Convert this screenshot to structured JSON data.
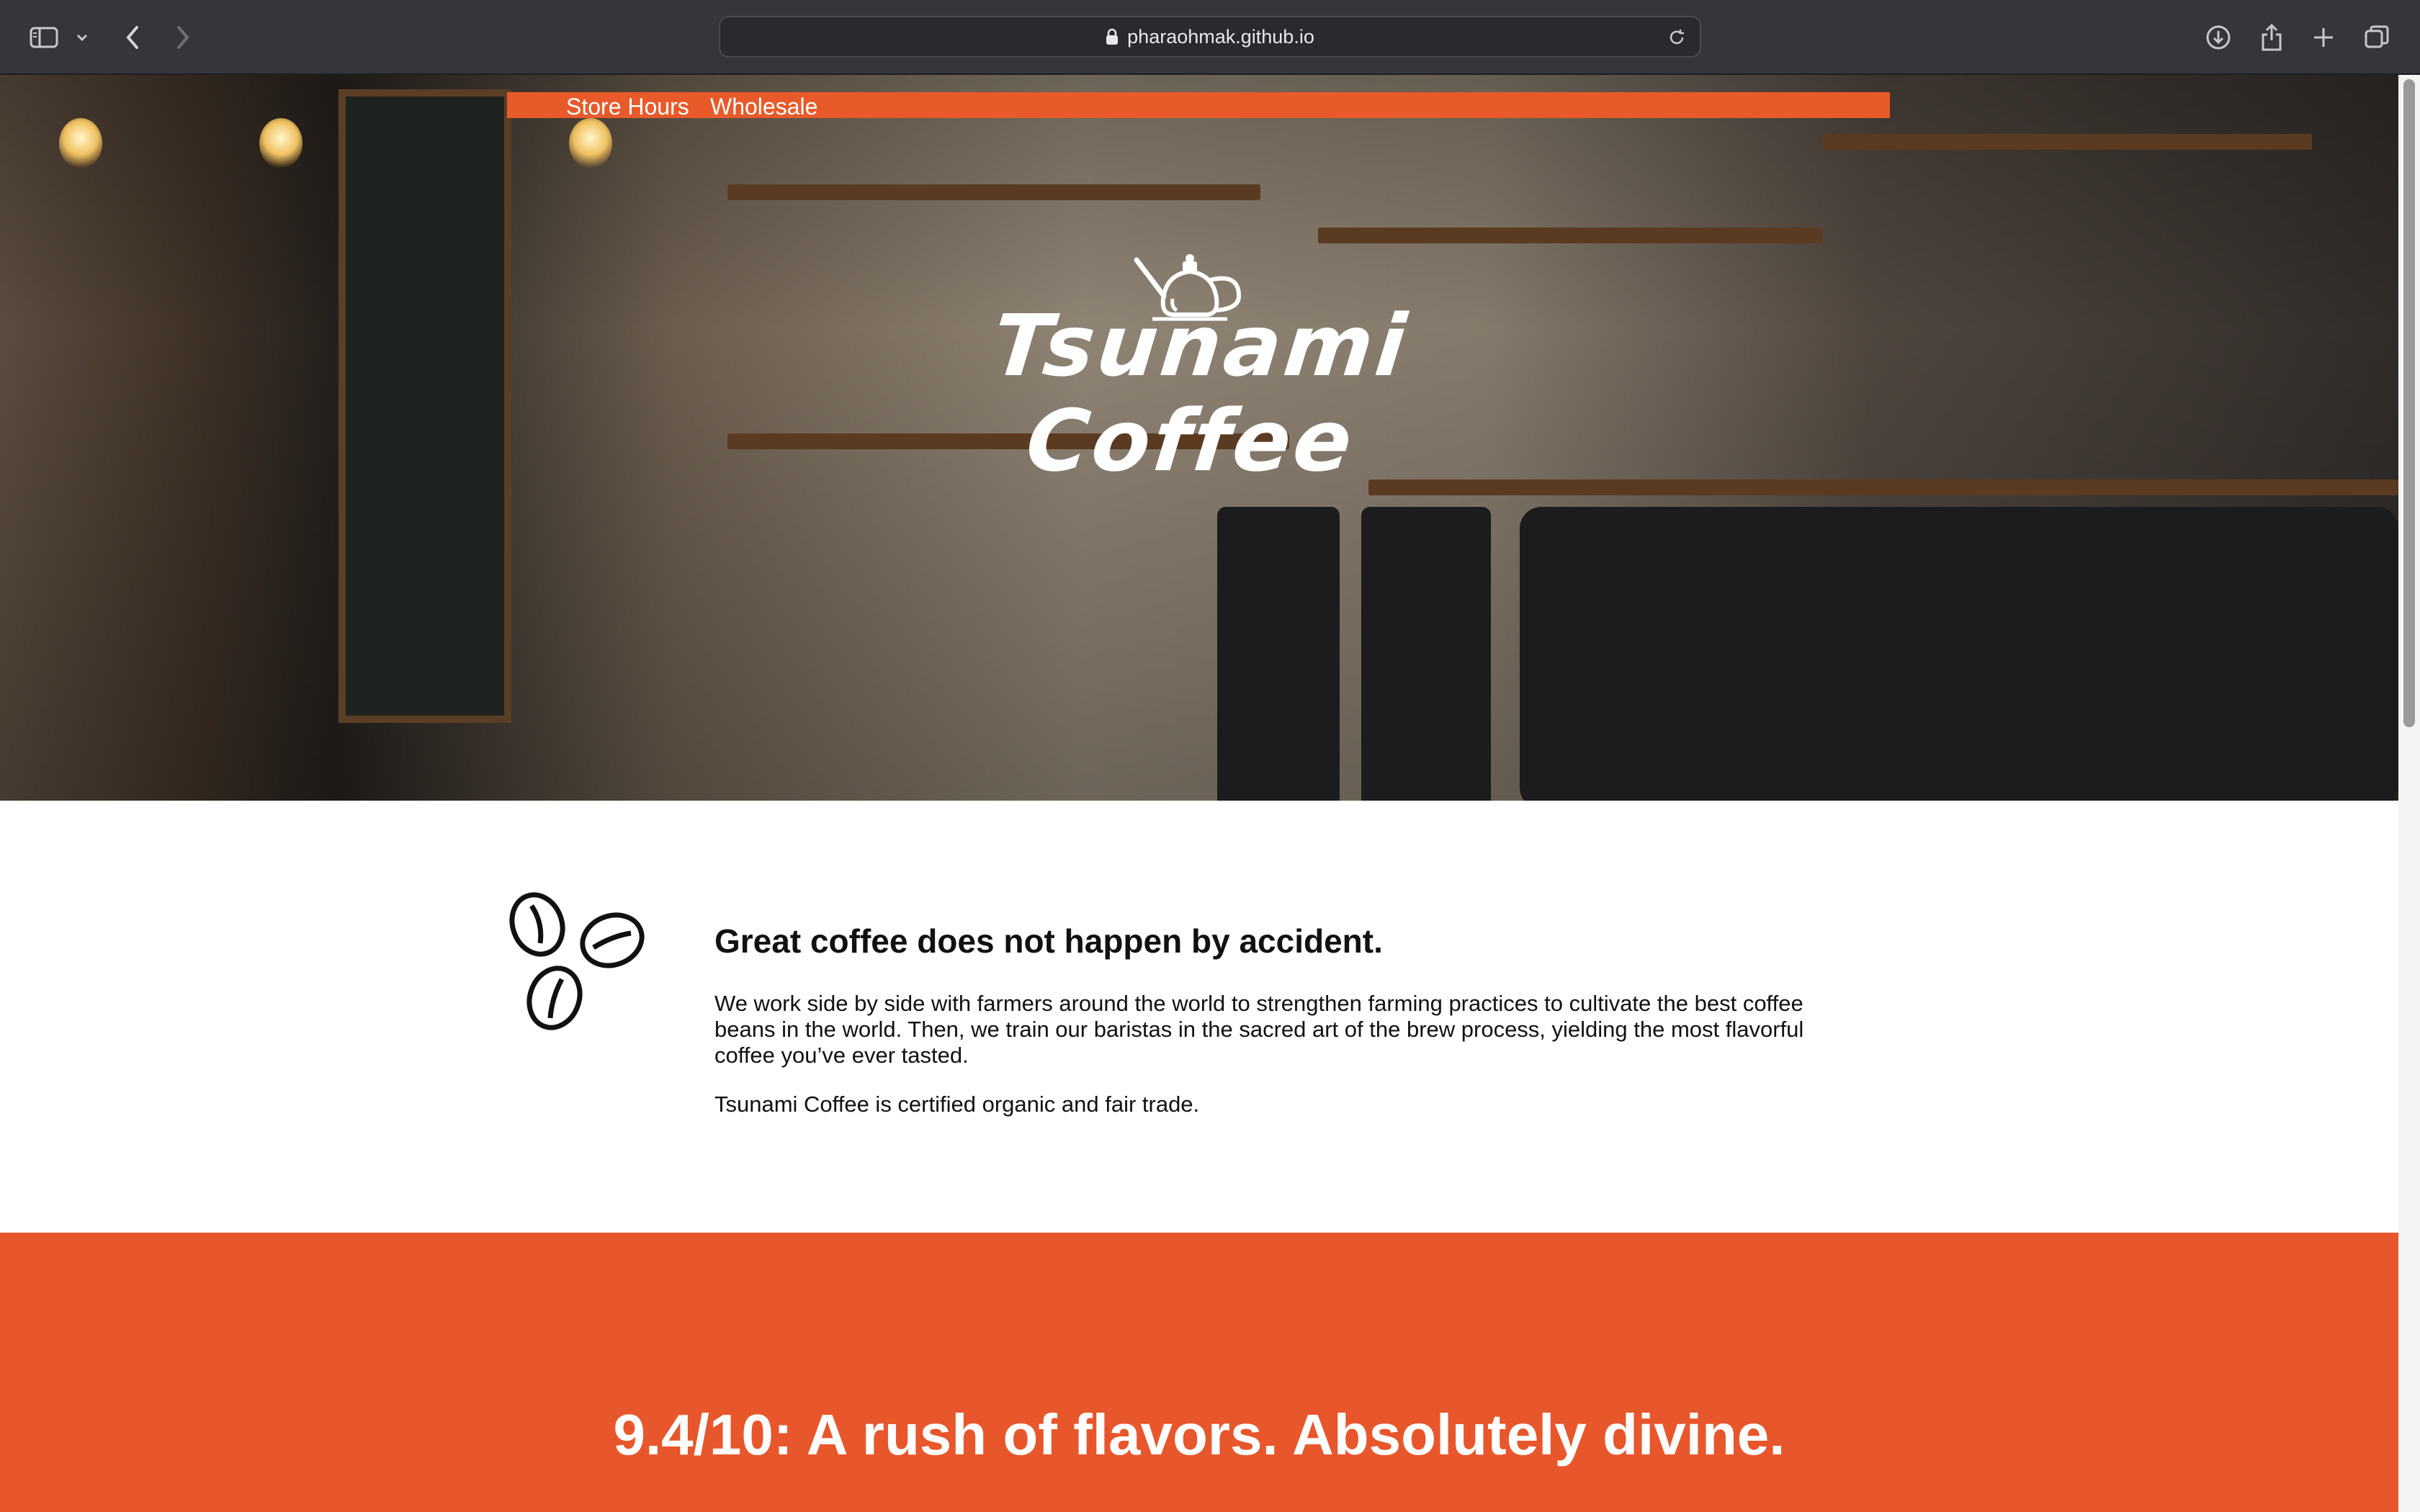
{
  "browser": {
    "url": "pharaohmak.github.io",
    "icons": [
      "sidebar-icon",
      "chevron-down-icon",
      "back-icon",
      "forward-icon",
      "lock-icon",
      "reload-icon",
      "download-icon",
      "share-icon",
      "new-tab-icon",
      "tabs-icon"
    ]
  },
  "nav": {
    "store_hours": "Store Hours",
    "wholesale": "Wholesale",
    "bar_color": "#e85a2a"
  },
  "hero": {
    "brand_line1": "Tsunami",
    "brand_line2": "Coffee"
  },
  "about": {
    "heading": "Great coffee does not happen by accident.",
    "paragraph1": "We work side by side with farmers around the world to strengthen farming practices to cultivate the best coffee beans in the world. Then, we train our baristas in the sacred art of the brew process, yielding the most flavorful coffee you’ve ever tasted.",
    "paragraph2": "Tsunami Coffee is certified organic and fair trade."
  },
  "review": {
    "quote": "9.4/10: A rush of flavors. Absolutely divine.",
    "bg_color": "#e8562b"
  }
}
